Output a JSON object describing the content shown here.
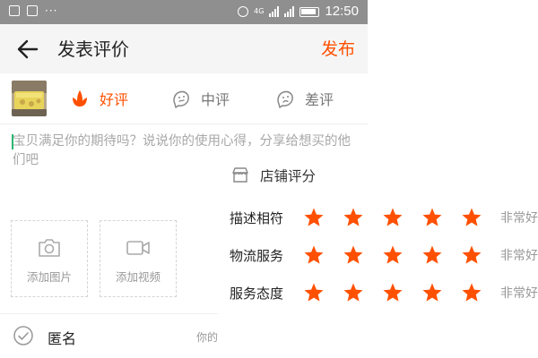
{
  "status_bar": {
    "network_label": "4G",
    "time": "12:50"
  },
  "title_bar": {
    "title": "发表评价",
    "publish_label": "发布"
  },
  "rating_options": [
    {
      "label": "好评",
      "selected": true,
      "icon": "flower-icon"
    },
    {
      "label": "中评",
      "selected": false,
      "icon": "neutral-face-icon"
    },
    {
      "label": "差评",
      "selected": false,
      "icon": "sad-face-icon"
    }
  ],
  "comment": {
    "placeholder": "宝贝满足你的期待吗？说说你的使用心得，分享给想买的他们吧"
  },
  "media": {
    "add_photo_label": "添加图片",
    "add_video_label": "添加视频"
  },
  "anonymous": {
    "label": "匿名",
    "note": "你的"
  },
  "shop_rating": {
    "title": "店铺评分",
    "rows": [
      {
        "label": "描述相符",
        "stars": 5,
        "verdict": "非常好"
      },
      {
        "label": "物流服务",
        "stars": 5,
        "verdict": "非常好"
      },
      {
        "label": "服务态度",
        "stars": 5,
        "verdict": "非常好"
      }
    ]
  },
  "colors": {
    "accent": "#ff5000",
    "star": "#ff5000",
    "muted_text": "#999999",
    "status_bar": "#8f8f8f",
    "cursor": "#2bb673"
  }
}
